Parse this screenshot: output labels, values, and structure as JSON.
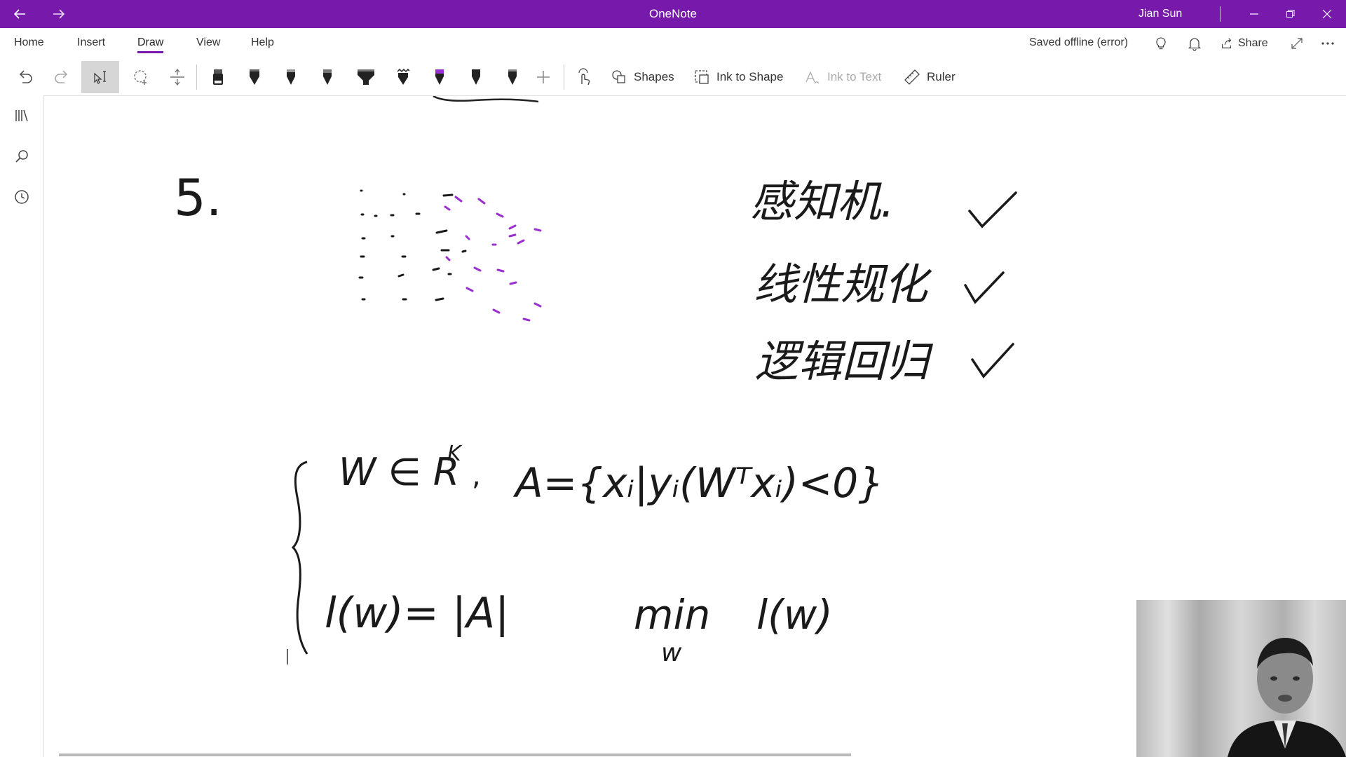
{
  "window": {
    "title": "OneNote",
    "user": "Jian Sun",
    "brand_color": "#7719aa"
  },
  "menu": {
    "tabs": [
      {
        "label": "Home"
      },
      {
        "label": "Insert"
      },
      {
        "label": "Draw",
        "active": true
      },
      {
        "label": "View"
      },
      {
        "label": "Help"
      }
    ],
    "status": "Saved offline (error)",
    "share_label": "Share"
  },
  "ribbon": {
    "shapes_label": "Shapes",
    "ink_to_shape_label": "Ink to Shape",
    "ink_to_text_label": "Ink to Text",
    "ruler_label": "Ruler",
    "pen_colors": [
      "#222222",
      "#222222",
      "#222222",
      "#222222",
      "#222222",
      "#222222",
      "#8a2be2",
      "#222222",
      "#222222"
    ]
  },
  "icons": {
    "left_rail": [
      "notebooks-icon",
      "search-icon",
      "recent-icon"
    ]
  },
  "canvas": {
    "item_number": "5.",
    "checklist": [
      {
        "text": "感知机.",
        "checked": true
      },
      {
        "text": "线性规化",
        "checked": true
      },
      {
        "text": "逻辑回归",
        "checked": true
      }
    ],
    "formula_line1_left": "W ∈ R",
    "formula_line1_sup": "K",
    "formula_line1_right": "A={xᵢ|yᵢ(Wᵀxᵢ)<0}",
    "formula_line2_left": "l(w)= |A|",
    "formula_line2_min": "min",
    "formula_line2_sub": "w",
    "formula_line2_right": "l(w)",
    "ink_color": "#1a1a1a",
    "purple_ink": "#9b30d0"
  }
}
